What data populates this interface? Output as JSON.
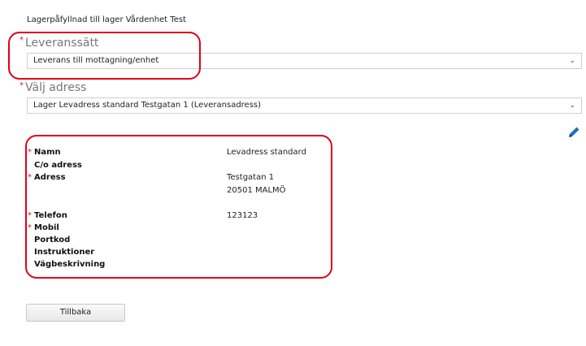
{
  "caption": "Lagerpåfyllnad till lager Vårdenhet Test",
  "required_mark": "*",
  "delivery": {
    "label": "Leveranssätt",
    "value": "Leverans till mottagning/enhet"
  },
  "address_select": {
    "label": "Välj adress",
    "value": "Lager Levadress standard Testgatan 1 (Leveransadress)"
  },
  "details": {
    "name_label": "Namn",
    "name_value": "Levadress standard",
    "co_label": "C/o adress",
    "address_label": "Adress",
    "address_line1": "Testgatan 1",
    "address_line2": "20501 MALMÖ",
    "phone_label": "Telefon",
    "phone_value": "123123",
    "mobile_label": "Mobil",
    "portcode_label": "Portkod",
    "instructions_label": "Instruktioner",
    "directions_label": "Vägbeskrivning"
  },
  "back_button": "Tillbaka",
  "colors": {
    "required": "#d11111",
    "annotation": "#e0001a",
    "accent": "#1f6fc5"
  },
  "icons": {
    "dropdown": "chevron-down-icon",
    "edit": "pencil-icon"
  }
}
